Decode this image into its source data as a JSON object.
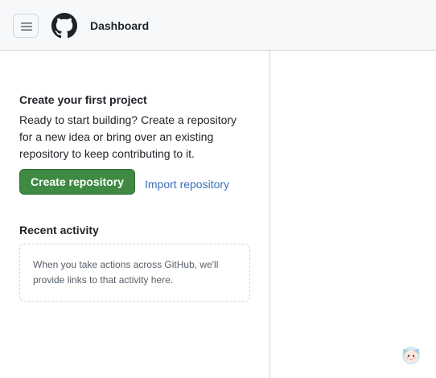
{
  "header": {
    "title": "Dashboard",
    "menu_icon": "hamburger-menu-icon",
    "logo_icon": "github-logo-icon"
  },
  "first_project": {
    "title": "Create your first project",
    "description": "Ready to start building? Create a repository for a new idea or bring over an existing repository to keep contributing to it.",
    "create_button": "Create repository",
    "import_link": "Import repository"
  },
  "recent_activity": {
    "title": "Recent activity",
    "empty_text": "When you take actions across GitHub, we'll provide links to that activity here."
  },
  "colors": {
    "primary_button": "#3f8a43",
    "link": "#3a6fb8",
    "header_bg": "#f6f8fa",
    "border": "#d0d7de"
  },
  "floating_avatar": {
    "icon": "assistant-avatar-icon"
  }
}
